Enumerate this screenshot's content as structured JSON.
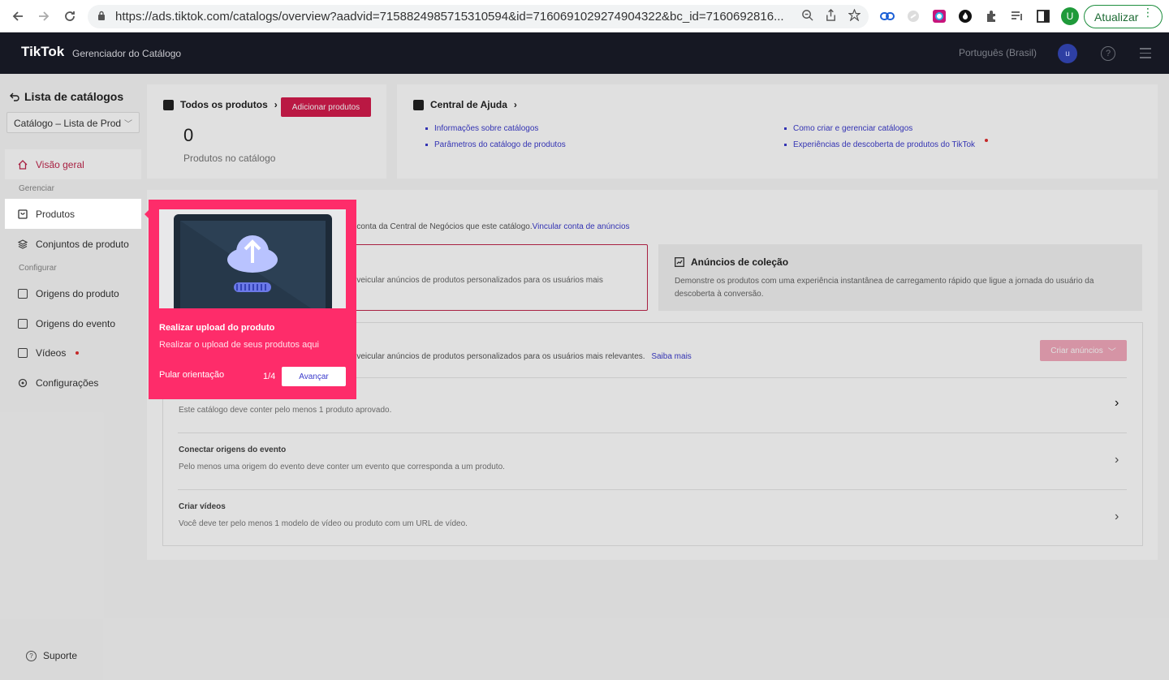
{
  "browser": {
    "url": "https://ads.tiktok.com/catalogs/overview?aadvid=7158824985715310594&id=7160691029274904322&bc_id=7160692816...",
    "update_label": "Atualizar",
    "profile_initial": "U"
  },
  "header": {
    "logo": "TikTok",
    "subtitle": "Gerenciador do Catálogo",
    "language": "Português (Brasil)",
    "avatar_initial": "u"
  },
  "sidebar": {
    "back_title": "Lista de catálogos",
    "catalog_select": "Catálogo – Lista de Prod",
    "overview": "Visão geral",
    "section_manage": "Gerenciar",
    "products": "Produtos",
    "product_sets": "Conjuntos de produto",
    "section_config": "Configurar",
    "product_sources": "Origens do produto",
    "event_sources": "Origens do evento",
    "videos": "Vídeos",
    "settings": "Configurações",
    "support": "Suporte"
  },
  "products_card": {
    "title": "Todos os produtos",
    "add_button": "Adicionar produtos",
    "count": "0",
    "caption": "Produtos no catálogo"
  },
  "help_card": {
    "title": "Central de Ajuda",
    "links": [
      "Informações sobre catálogos",
      "Parâmetros do catálogo de produtos",
      "Como criar e gerenciar catálogos",
      "Experiências de descoberta de produtos do TikTok"
    ]
  },
  "ads_section": {
    "link_text_fragment": "a conta da Central de Negócios que este catálogo.",
    "link": "Vincular conta de anúncios",
    "card1_desc": "o veicular anúncios de produtos personalizados para os usuários mais",
    "card2_title": "Anúncios de coleção",
    "card2_desc": "Demonstre os produtos com uma experiência instantânea de carregamento rápido que ligue a jornada do usuário da descoberta à conversão.",
    "steps_intro": "o veicular anúncios de produtos personalizados para os usuários mais relevantes.",
    "learn_more": "Saiba mais",
    "create_ads": "Criar anúncios",
    "steps": [
      {
        "title": "",
        "desc": "Este catálogo deve conter pelo menos 1 produto aprovado."
      },
      {
        "title": "Conectar origens do evento",
        "desc": "Pelo menos uma origem do evento deve conter um evento que corresponda a um produto."
      },
      {
        "title": "Criar vídeos",
        "desc": "Você deve ter pelo menos 1 modelo de vídeo ou produto com um URL de vídeo."
      }
    ]
  },
  "tour": {
    "title": "Realizar upload do produto",
    "description": "Realizar o upload de seus produtos aqui",
    "skip": "Pular orientação",
    "counter": "1/4",
    "next": "Avançar"
  }
}
